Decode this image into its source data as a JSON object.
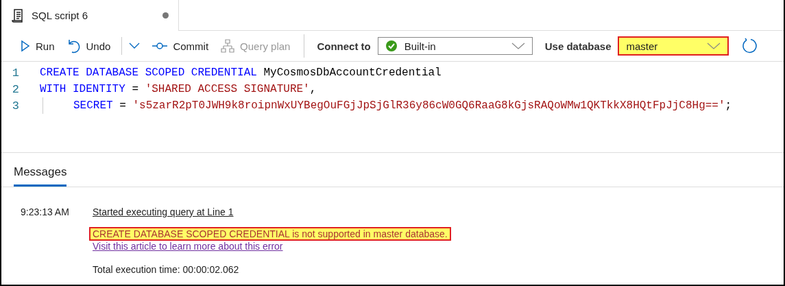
{
  "tab": {
    "title": "SQL script 6",
    "unsaved": true
  },
  "toolbar": {
    "buttons": [
      {
        "kind": "run",
        "label": "Run"
      },
      {
        "kind": "undo",
        "label": "Undo"
      },
      {
        "kind": "dropdown"
      },
      {
        "kind": "commit",
        "label": "Commit"
      },
      {
        "kind": "plan",
        "label": "Query plan",
        "disabled": true
      }
    ],
    "connect_label": "Connect to",
    "connect_value": "Built-in",
    "database_label": "Use database",
    "database_value": "master",
    "database_highlighted": true
  },
  "editor": {
    "lines": [
      {
        "number": "1",
        "indent": false,
        "tokens": [
          {
            "kind": "keyword",
            "text": "CREATE DATABASE SCOPED CREDENTIAL"
          },
          {
            "kind": "plain",
            "text": " MyCosmosDbAccountCredential"
          }
        ]
      },
      {
        "number": "2",
        "indent": false,
        "tokens": [
          {
            "kind": "keyword",
            "text": "WITH IDENTITY"
          },
          {
            "kind": "plain",
            "text": " = "
          },
          {
            "kind": "string",
            "text": "'SHARED ACCESS SIGNATURE'"
          },
          {
            "kind": "plain",
            "text": ","
          }
        ]
      },
      {
        "number": "3",
        "indent": true,
        "tokens": [
          {
            "kind": "keyword",
            "text": "SECRET"
          },
          {
            "kind": "plain",
            "text": " = "
          },
          {
            "kind": "string",
            "text": "'s5zarR2pT0JWH9k8roipnWxUYBegOuFGjJpSjGlR36y86cW0GQ6RaaG8kGjsRAQoWMw1QKTkkX8HQtFpJjC8Hg=='"
          },
          {
            "kind": "plain",
            "text": ";"
          }
        ]
      }
    ]
  },
  "results": {
    "tabs": [
      {
        "label": "Messages",
        "selected": true
      }
    ],
    "messages": {
      "time": "9:23:13 AM",
      "started": "Started executing query at Line 1",
      "error": "CREATE DATABASE SCOPED CREDENTIAL is not supported in master database.",
      "error_highlighted": true,
      "help_link": "Visit this article to learn more about this error",
      "total": "Total execution time: 00:00:02.062"
    }
  }
}
